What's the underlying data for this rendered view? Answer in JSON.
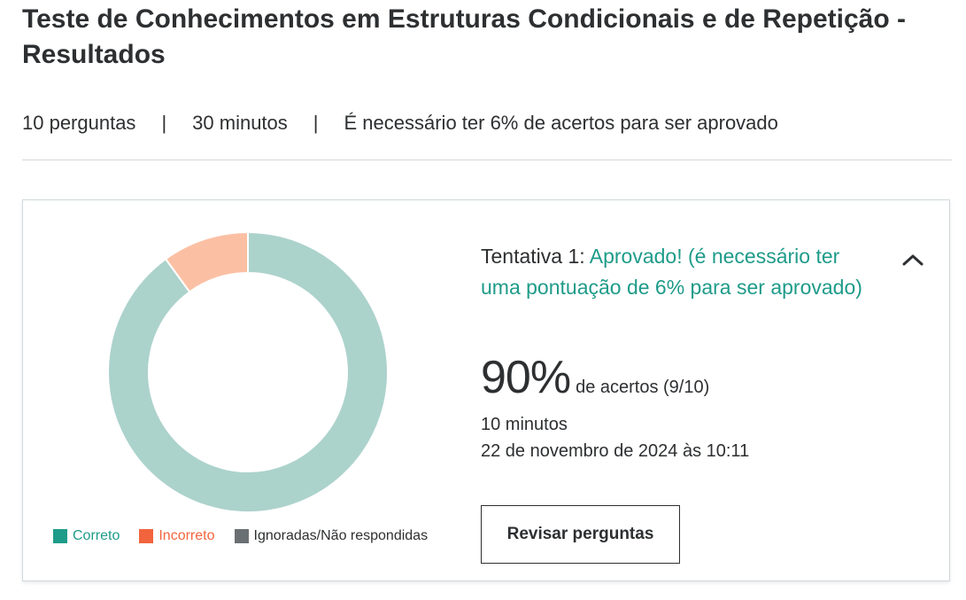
{
  "page": {
    "title": "Teste de Conhecimentos em Estruturas Condicionais e de Repetição - Resultados"
  },
  "meta": {
    "questions": "10 perguntas",
    "separator1": "|",
    "duration": "30 minutos",
    "separator2": "|",
    "pass_requirement": "É necessário ter 6% de acertos para ser aprovado"
  },
  "result": {
    "attempt_label": "Tentativa 1:",
    "status_text": "Aprovado! (é necessário ter uma pontuação de 6% para ser aprovado)",
    "score": "90%",
    "score_desc": "de acertos (9/10)",
    "time_taken": "10 minutos",
    "date": "22 de novembro de 2024 às 10:11",
    "review_button": "Revisar perguntas",
    "expanded": true,
    "collapse_icon": "chevron-up-icon"
  },
  "chart_data": {
    "type": "pie",
    "donut": true,
    "slices": [
      {
        "label": "Correto",
        "value": 9,
        "color": "#acd2cc",
        "legend_color": "#1e9b89"
      },
      {
        "label": "Incorreto",
        "value": 1,
        "color": "#fbc0a4",
        "legend_color": "#f2643d"
      },
      {
        "label": "Ignoradas/Não respondidas",
        "value": 0,
        "color": "#6a6f73",
        "legend_color": "#6a6f73"
      }
    ]
  },
  "legend": {
    "items": [
      {
        "label": "Correto",
        "color": "#1e9b89",
        "text_color": "#1e9b89"
      },
      {
        "label": "Incorreto",
        "color": "#f2643d",
        "text_color": "#f2643d"
      },
      {
        "label": "Ignoradas/Não respondidas",
        "color": "#6a6f73",
        "text_color": "#2d2f31"
      }
    ]
  }
}
